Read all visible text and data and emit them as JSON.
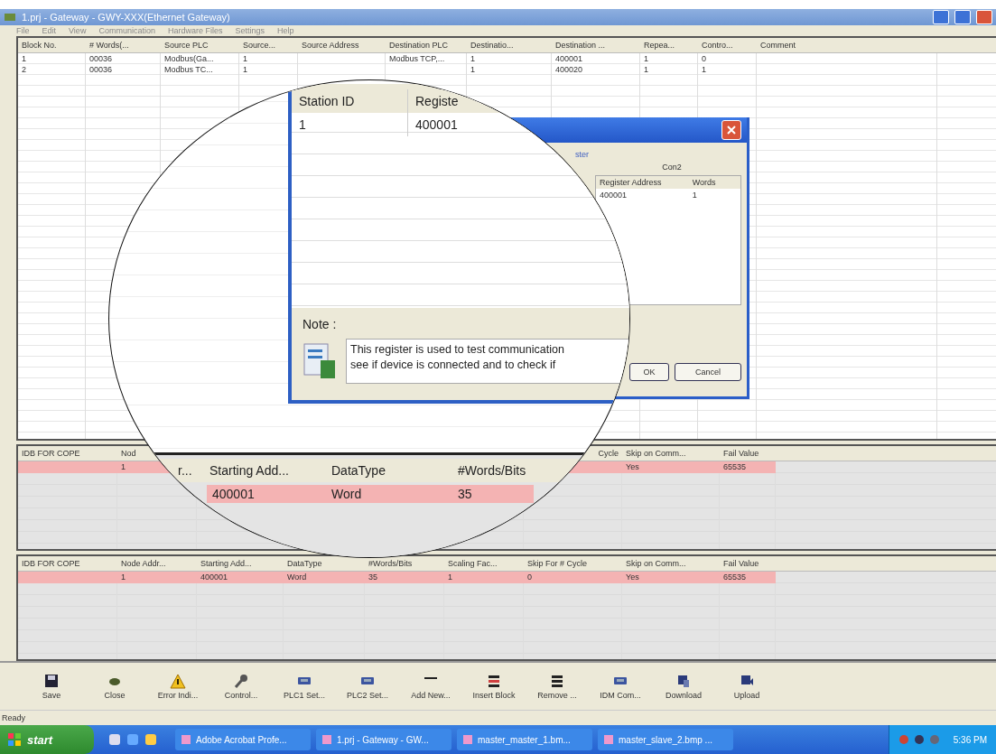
{
  "window": {
    "title": "1.prj - Gateway - GWY-XXX(Ethernet Gateway)",
    "menu": [
      "File",
      "Edit",
      "View",
      "Communication",
      "Hardware Files",
      "Settings",
      "Help"
    ]
  },
  "block_table": {
    "columns": [
      "Block No.",
      "# Words(...",
      "Source PLC",
      "Source...",
      "Source Address",
      "Destination PLC",
      "Destinatio...",
      "Destination ...",
      "Repea...",
      "Contro...",
      "Comment"
    ],
    "rows": [
      {
        "cells": [
          "1",
          "00036",
          "Modbus(Ga...",
          "1",
          null,
          "Modbus TCP,...",
          "1",
          "400001",
          "1",
          "0"
        ]
      },
      {
        "cells": [
          "2",
          "00036",
          "Modbus TC...",
          "1",
          null,
          null,
          "1",
          "400020",
          "1",
          "1"
        ]
      }
    ]
  },
  "idb_table_upper": {
    "columns": [
      "IDB FOR COPE",
      "Nod",
      null,
      null,
      null,
      null,
      "Cycle",
      "Skip on Comm...",
      "Fail Value"
    ],
    "rows": [
      {
        "highlighted": true,
        "cells": [
          null,
          "1",
          null,
          null,
          null,
          null,
          null,
          "Yes",
          "65535"
        ]
      }
    ]
  },
  "idb_table_lower": {
    "columns": [
      "IDB FOR COPE",
      "Node Addr...",
      "Starting Add...",
      "DataType",
      "#Words/Bits",
      "Scaling Fac...",
      "Skip For # Cycle",
      "Skip on Comm...",
      "Fail Value"
    ],
    "rows": [
      {
        "highlighted": true,
        "cells": [
          null,
          "1",
          "400001",
          "Word",
          "35",
          "1",
          "0",
          "Yes",
          "65535"
        ]
      }
    ]
  },
  "dialog": {
    "group_label": "ster",
    "header": "Con2",
    "columns": [
      "Register Address",
      "Words"
    ],
    "rows": [
      [
        "400001",
        "1"
      ]
    ],
    "buttons": [
      "OK",
      "Cancel"
    ]
  },
  "magnifier": {
    "station_table": {
      "columns": [
        "Station ID",
        "Registe"
      ],
      "rows": [
        [
          "1",
          "400001"
        ]
      ]
    },
    "note_label": "Note :",
    "note_lines": [
      "This register is used to test communication",
      "see if device is connected and to check if"
    ],
    "idb_table": {
      "columns": [
        "r...",
        "Starting Add...",
        "DataType",
        "#Words/Bits"
      ],
      "rows": [
        {
          "highlighted": true,
          "cells": [
            "",
            "400001",
            "Word",
            "35"
          ]
        }
      ]
    }
  },
  "toolbar": [
    {
      "kind": "floppy",
      "label": "Save"
    },
    {
      "kind": "blob",
      "label": "Close"
    },
    {
      "kind": "warning",
      "label": "Error Indi..."
    },
    {
      "kind": "wrench",
      "label": "Control..."
    },
    {
      "kind": "device",
      "label": "PLC1 Set..."
    },
    {
      "kind": "device",
      "label": "PLC2 Set..."
    },
    {
      "kind": "dash",
      "label": "Add New..."
    },
    {
      "kind": "rows-red",
      "label": "Insert Block"
    },
    {
      "kind": "rows",
      "label": "Remove ..."
    },
    {
      "kind": "device",
      "label": "IDM Com..."
    },
    {
      "kind": "download",
      "label": "Download"
    },
    {
      "kind": "upload",
      "label": "Upload"
    }
  ],
  "status_bar": "Ready",
  "taskbar": {
    "start": "start",
    "tasks": [
      "Adobe Acrobat Profe...",
      "1.prj - Gateway - GW...",
      "master_master_1.bm...",
      "master_slave_2.bmp ..."
    ],
    "clock": "5:36 PM"
  }
}
